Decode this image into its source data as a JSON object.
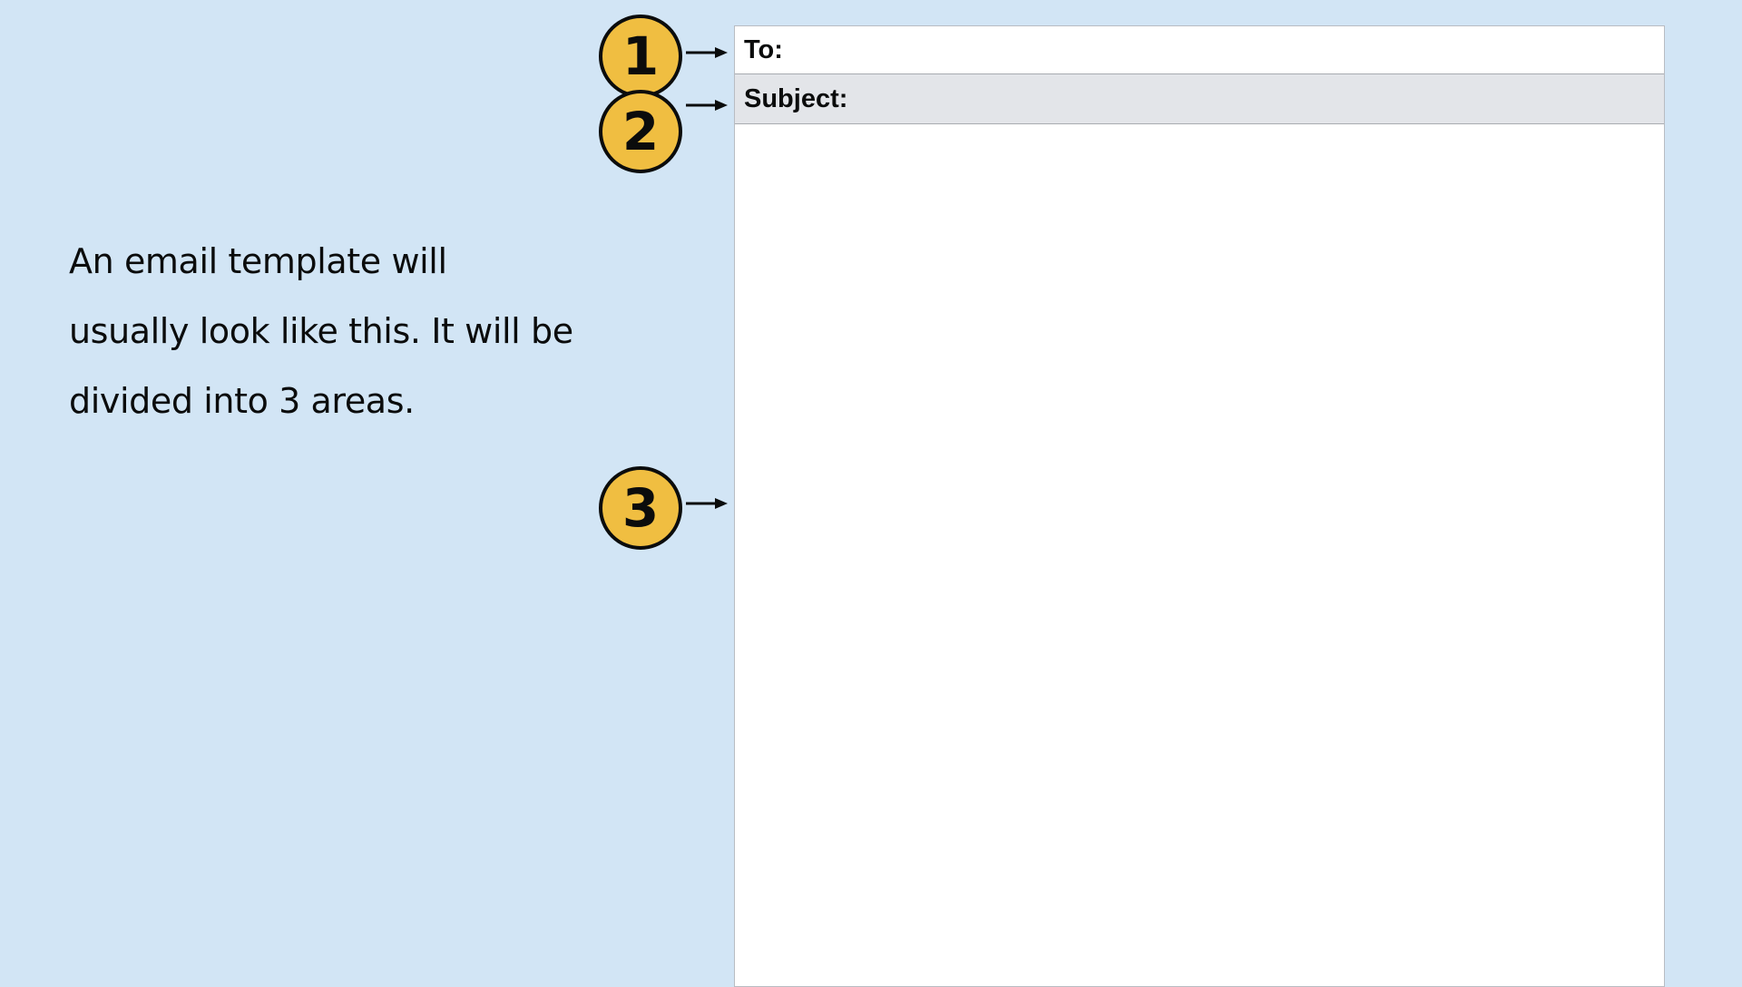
{
  "intro": {
    "text": "An email template will usually look like this. It will be divided into 3 areas."
  },
  "email": {
    "to_label": "To:",
    "subject_label": "Subject:"
  },
  "markers": [
    {
      "number": "1",
      "target": "to-field"
    },
    {
      "number": "2",
      "target": "subject-field"
    },
    {
      "number": "3",
      "target": "message-body"
    }
  ],
  "colors": {
    "background": "#d2e5f5",
    "marker_fill": "#f0be41",
    "subject_row": "#e3e5e9",
    "window": "#ffffff"
  },
  "icons": {
    "arrow": "arrow-right-icon"
  }
}
